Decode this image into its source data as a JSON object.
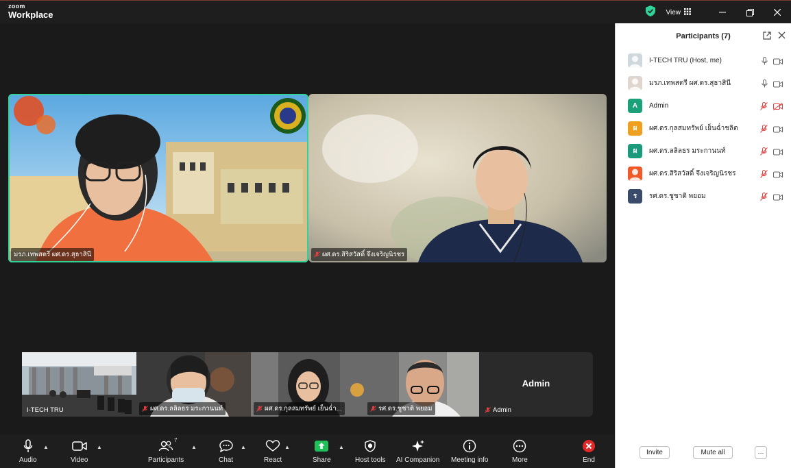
{
  "app": {
    "brand_small": "zoom",
    "brand_large": "Workplace",
    "view_label": "View"
  },
  "colors": {
    "accent_green": "#2fd39a",
    "end_red": "#e02828",
    "share_green": "#1fbf5a"
  },
  "stage": {
    "main_tiles": [
      {
        "name": "มรภ.เทพสตรี ผศ.ดร.สุธาสินี",
        "active": true,
        "muted": false
      },
      {
        "name": "ผศ.ดร.สิริสวัสดิ์ จึงเจริญนิรชร",
        "active": false,
        "muted": true
      }
    ],
    "strip_tiles": [
      {
        "name": "I-TECH TRU",
        "muted": false
      },
      {
        "name": "ผศ.ดร.ลลิลธร มระกานนท์",
        "muted": true
      },
      {
        "name": "ผศ.ดร.กุลสมทรัพย์  เย็นฉ่ำ...",
        "muted": true
      },
      {
        "name": "รศ.ดร.ชูชาติ  พยอม",
        "muted": true
      },
      {
        "name": "Admin",
        "muted": true,
        "big_name": "Admin"
      }
    ]
  },
  "controls": {
    "audio": "Audio",
    "video": "Video",
    "participants": "Participants",
    "participants_count": "7",
    "chat": "Chat",
    "react": "React",
    "share": "Share",
    "host_tools": "Host tools",
    "ai_companion": "AI Companion",
    "meeting_info": "Meeting info",
    "more": "More",
    "end": "End"
  },
  "panel": {
    "title": "Participants (7)",
    "participants": [
      {
        "name": "I-TECH TRU (Host, me)",
        "avatar_letter": "",
        "avatar_color": "#cfd8dc",
        "mic_muted": false,
        "video_off": false
      },
      {
        "name": "มรภ.เทพสตรี ผศ.ดร.สุธาสินี",
        "avatar_letter": "",
        "avatar_color": "#e0d6d0",
        "mic_muted": false,
        "video_off": false
      },
      {
        "name": "Admin",
        "avatar_letter": "A",
        "avatar_color": "#1aa179",
        "mic_muted": true,
        "video_off": true
      },
      {
        "name": "ผศ.ดร.กุลสมทรัพย์  เย็นฉ่ำชลิต",
        "avatar_letter": "ผ",
        "avatar_color": "#f0a020",
        "mic_muted": true,
        "video_off": false
      },
      {
        "name": "ผศ.ดร.ลลิลธร มระกานนท์",
        "avatar_letter": "ผ",
        "avatar_color": "#1a9a7a",
        "mic_muted": true,
        "video_off": false
      },
      {
        "name": "ผศ.ดร.สิริสวัสดิ์ จึงเจริญนิรชร",
        "avatar_letter": "",
        "avatar_color": "#f05a28",
        "mic_muted": true,
        "video_off": false
      },
      {
        "name": "รศ.ดร.ชูชาติ  พยอม",
        "avatar_letter": "ร",
        "avatar_color": "#3a4a6a",
        "mic_muted": true,
        "video_off": false
      }
    ],
    "invite": "Invite",
    "mute_all": "Mute all",
    "more": "···"
  }
}
